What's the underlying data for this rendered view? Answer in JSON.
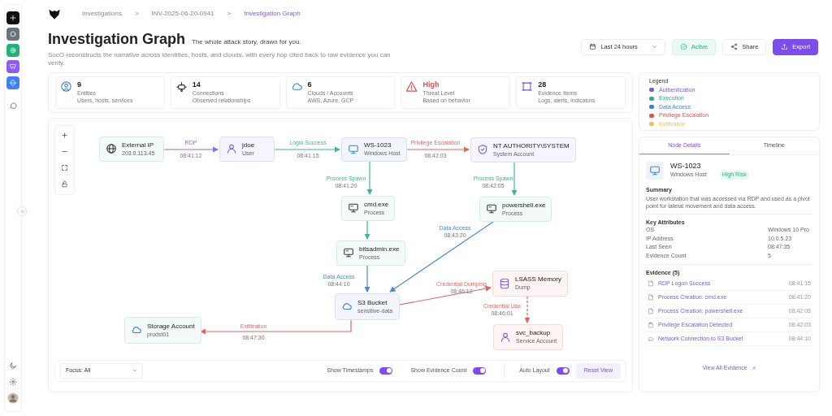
{
  "sidebar": {
    "items": [
      {
        "color": "#111111"
      },
      {
        "color": "#6b7280"
      },
      {
        "color": "#22b07d"
      },
      {
        "color": "#8b5cf6"
      },
      {
        "color": "#3b82f6"
      }
    ]
  },
  "breadcrumb": [
    {
      "label": "Investigations",
      "selected": false
    },
    {
      "label": "INV-2025-06-20-0941",
      "selected": false
    },
    {
      "label": "Investigation Graph",
      "selected": true
    }
  ],
  "breadcrumb_separator": ">",
  "title": "Investigation Graph",
  "tagline": "The whole attack story, drawn for you.",
  "description": "SocO reconstructs the narrative across identities, hosts, and clouds, with every hop cited back to raw evidence you can verify.",
  "actions": [
    {
      "kind": "select",
      "label": "Last 24 hours"
    },
    {
      "kind": "status",
      "label": "Active"
    },
    {
      "kind": "default",
      "label": "Share"
    },
    {
      "kind": "primary",
      "label": "Export"
    }
  ],
  "stats": [
    {
      "value": "9",
      "label": "Entities",
      "sub": "Users, hosts, services",
      "alert": false
    },
    {
      "value": "14",
      "label": "Connections",
      "sub": "Observed relationships",
      "alert": false
    },
    {
      "value": "6",
      "label": "Clouds / Accounts",
      "sub": "AWS, Azure, GCP",
      "alert": false
    },
    {
      "value": "High",
      "label": "Threat Level",
      "sub": "Based on behavior",
      "alert": true
    },
    {
      "value": "28",
      "label": "Evidence Items",
      "sub": "Logs, alerts, indicators",
      "alert": false
    }
  ],
  "graph": {
    "nodes": [
      {
        "name": "External IP",
        "type": "203.0.113.45"
      },
      {
        "name": "jdoe",
        "type": "User"
      },
      {
        "name": "WS-1023",
        "type": "Windows Host"
      },
      {
        "name": "NT AUTHORITY\\SYSTEM",
        "type": "System Account"
      },
      {
        "name": "cmd.exe",
        "type": "Process"
      },
      {
        "name": "powershell.exe",
        "type": "Process"
      },
      {
        "name": "bitsadmin.exe",
        "type": "Process"
      },
      {
        "name": "S3 Bucket",
        "type": "sensitive-data"
      },
      {
        "name": "LSASS Memory",
        "type": "Dump"
      },
      {
        "name": "svc_backup",
        "type": "Service Account"
      },
      {
        "name": "Storage Account",
        "type": "prodst01"
      }
    ],
    "edges": [
      {
        "label": "RDP",
        "time": "08:41:12",
        "kind": "solid"
      },
      {
        "label": "Login Success",
        "time": "08:41:15",
        "kind": "solid"
      },
      {
        "label": "Privilege Escalation",
        "time": "08:42:03",
        "kind": "solid"
      },
      {
        "label": "Process Spawn",
        "time": "08:41:20",
        "kind": "solid"
      },
      {
        "label": "Process Spawn",
        "time": "08:42:05",
        "kind": "solid"
      },
      {
        "kind": "solid"
      },
      {
        "label": "Data Access",
        "time": "08:44:10",
        "kind": "solid"
      },
      {
        "label": "Data Access",
        "time": "08:43:20",
        "kind": "solid"
      },
      {
        "label": "Credential Dumping",
        "time": "08:46:12",
        "kind": "solid"
      },
      {
        "label": "Credential Use",
        "time": "08:46:01",
        "kind": "dashed"
      },
      {
        "label": "Exfiltration",
        "time": "08:47:30",
        "kind": "solid"
      }
    ]
  },
  "toolbar": {
    "focus": "Focus: All",
    "toggles": [
      {
        "label": "Show Timestamps",
        "on": true
      },
      {
        "label": "Show Evidence Count",
        "on": true
      },
      {
        "label": "Auto Layout",
        "on": true
      }
    ],
    "reset": "Reset View"
  },
  "legend": {
    "title": "Legend",
    "items": [
      {
        "label": "Authentication",
        "color": "#7c5cd6"
      },
      {
        "label": "Execution",
        "color": "#2fae7e"
      },
      {
        "label": "Data Access",
        "color": "#3b82d6"
      },
      {
        "label": "Privilege Escalation",
        "color": "#d9534f"
      },
      {
        "label": "Exfiltration",
        "color": "#e8c36a"
      }
    ]
  },
  "details": {
    "tabs": [
      {
        "label": "Node Details",
        "selected": true
      },
      {
        "label": "Timeline",
        "selected": false
      }
    ],
    "name": "WS-1023",
    "type": "Windows Host",
    "risk": "High Risk",
    "summary_title": "Summary",
    "summary": "User workstation that was accessed via RDP and used as a pivot point for lateral movement and data access.",
    "attributes_title": "Key Attributes",
    "attributes": [
      {
        "label": "OS",
        "value": "Windows 10 Pro"
      },
      {
        "label": "IP Address",
        "value": "10.0.5.23"
      },
      {
        "label": "Last Seen",
        "value": "08:47:35"
      },
      {
        "label": "Evidence Count",
        "value": "5"
      }
    ],
    "evidence_title": "Evidence (5)",
    "evidence": [
      {
        "title": "RDP Logon Success",
        "time": "08:41:15"
      },
      {
        "title": "Process Creation: cmd.exe",
        "time": "08:41:20"
      },
      {
        "title": "Process Creation: powershell.exe",
        "time": "08:42:05"
      },
      {
        "title": "Privilege Escalation Detected",
        "time": "08:42:03"
      },
      {
        "title": "Network Connection to S3 Bucket",
        "time": "08:44:10"
      }
    ],
    "view_all": "View All Evidence"
  }
}
